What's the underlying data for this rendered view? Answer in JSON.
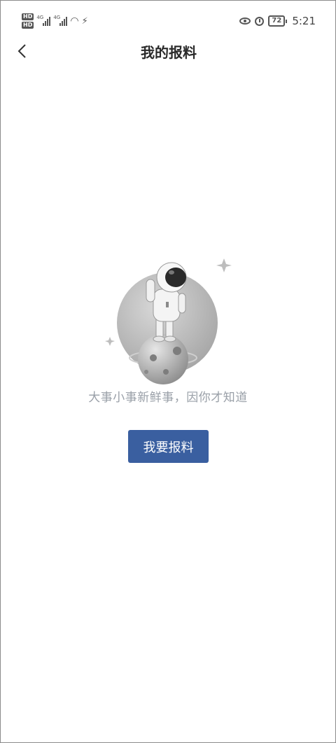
{
  "status_bar": {
    "hd_badges": [
      "HD",
      "HD"
    ],
    "network_1": "4G",
    "network_2": "4G",
    "boost_icon": "boost-icon",
    "battery": "72",
    "time": "5:21"
  },
  "nav": {
    "back_icon": "chevron-left-icon",
    "title": "我的报料"
  },
  "empty_state": {
    "illustration": "astronaut-on-planet-illustration",
    "slogan": "大事小事新鲜事，因你才知道",
    "button_label": "我要报料"
  },
  "colors": {
    "accent": "#3a5fa0",
    "slogan_text": "#9aa0a8",
    "background": "#ffffff"
  }
}
